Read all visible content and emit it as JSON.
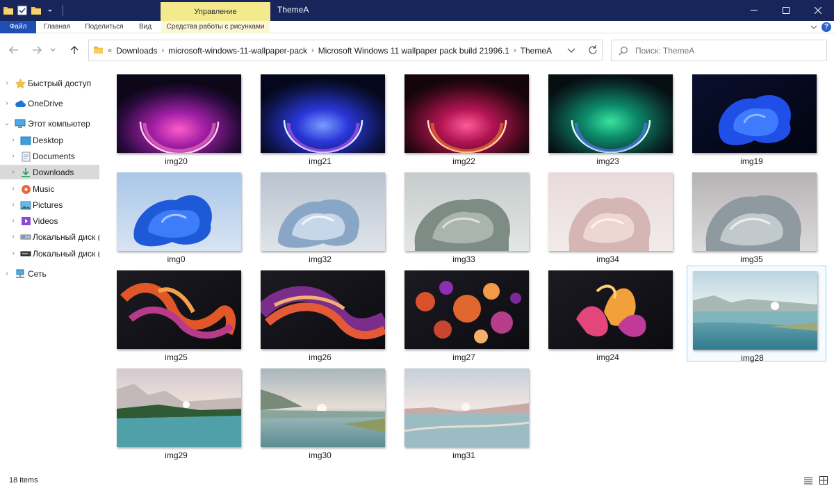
{
  "window": {
    "title": "ThemeA",
    "contextual_tab": "Управление"
  },
  "ribbon": {
    "tabs": [
      "Файл",
      "Главная",
      "Поделиться",
      "Вид",
      "Средства работы с рисунками"
    ]
  },
  "address": {
    "overflow": "«",
    "crumbs": [
      "Downloads",
      "microsoft-windows-11-wallpaper-pack",
      "Microsoft Windows 11 wallpaper pack build 21996.1",
      "ThemeA"
    ]
  },
  "search": {
    "placeholder": "Поиск: ThemeA"
  },
  "nav": {
    "items": [
      {
        "label": "Быстрый доступ",
        "icon": "star-icon"
      },
      {
        "label": "OneDrive",
        "icon": "cloud-icon"
      },
      {
        "label": "Этот компьютер",
        "icon": "computer-icon"
      },
      {
        "label": "Desktop",
        "icon": "desktop-icon"
      },
      {
        "label": "Documents",
        "icon": "documents-icon"
      },
      {
        "label": "Downloads",
        "icon": "download-icon"
      },
      {
        "label": "Music",
        "icon": "music-icon"
      },
      {
        "label": "Pictures",
        "icon": "pictures-icon"
      },
      {
        "label": "Videos",
        "icon": "videos-icon"
      },
      {
        "label": "Локальный диск (С",
        "icon": "drive-icon"
      },
      {
        "label": "Локальный диск (D",
        "icon": "drive-icon"
      },
      {
        "label": "Сеть",
        "icon": "network-icon"
      }
    ]
  },
  "files": [
    {
      "name": "img20"
    },
    {
      "name": "img21"
    },
    {
      "name": "img22"
    },
    {
      "name": "img23"
    },
    {
      "name": "img19"
    },
    {
      "name": "img0"
    },
    {
      "name": "img32"
    },
    {
      "name": "img33"
    },
    {
      "name": "img34"
    },
    {
      "name": "img35"
    },
    {
      "name": "img25"
    },
    {
      "name": "img26"
    },
    {
      "name": "img27"
    },
    {
      "name": "img24"
    },
    {
      "name": "img28"
    },
    {
      "name": "img29"
    },
    {
      "name": "img30"
    },
    {
      "name": "img31"
    }
  ],
  "status": {
    "item_count": "18 items"
  },
  "colors": {
    "titlebar": "#17255a",
    "file_tab": "#1e4fb7",
    "contextual_tab": "#f2ea8c",
    "selection": "#d9d9d9",
    "tile_selected_border": "#99d1ff"
  }
}
